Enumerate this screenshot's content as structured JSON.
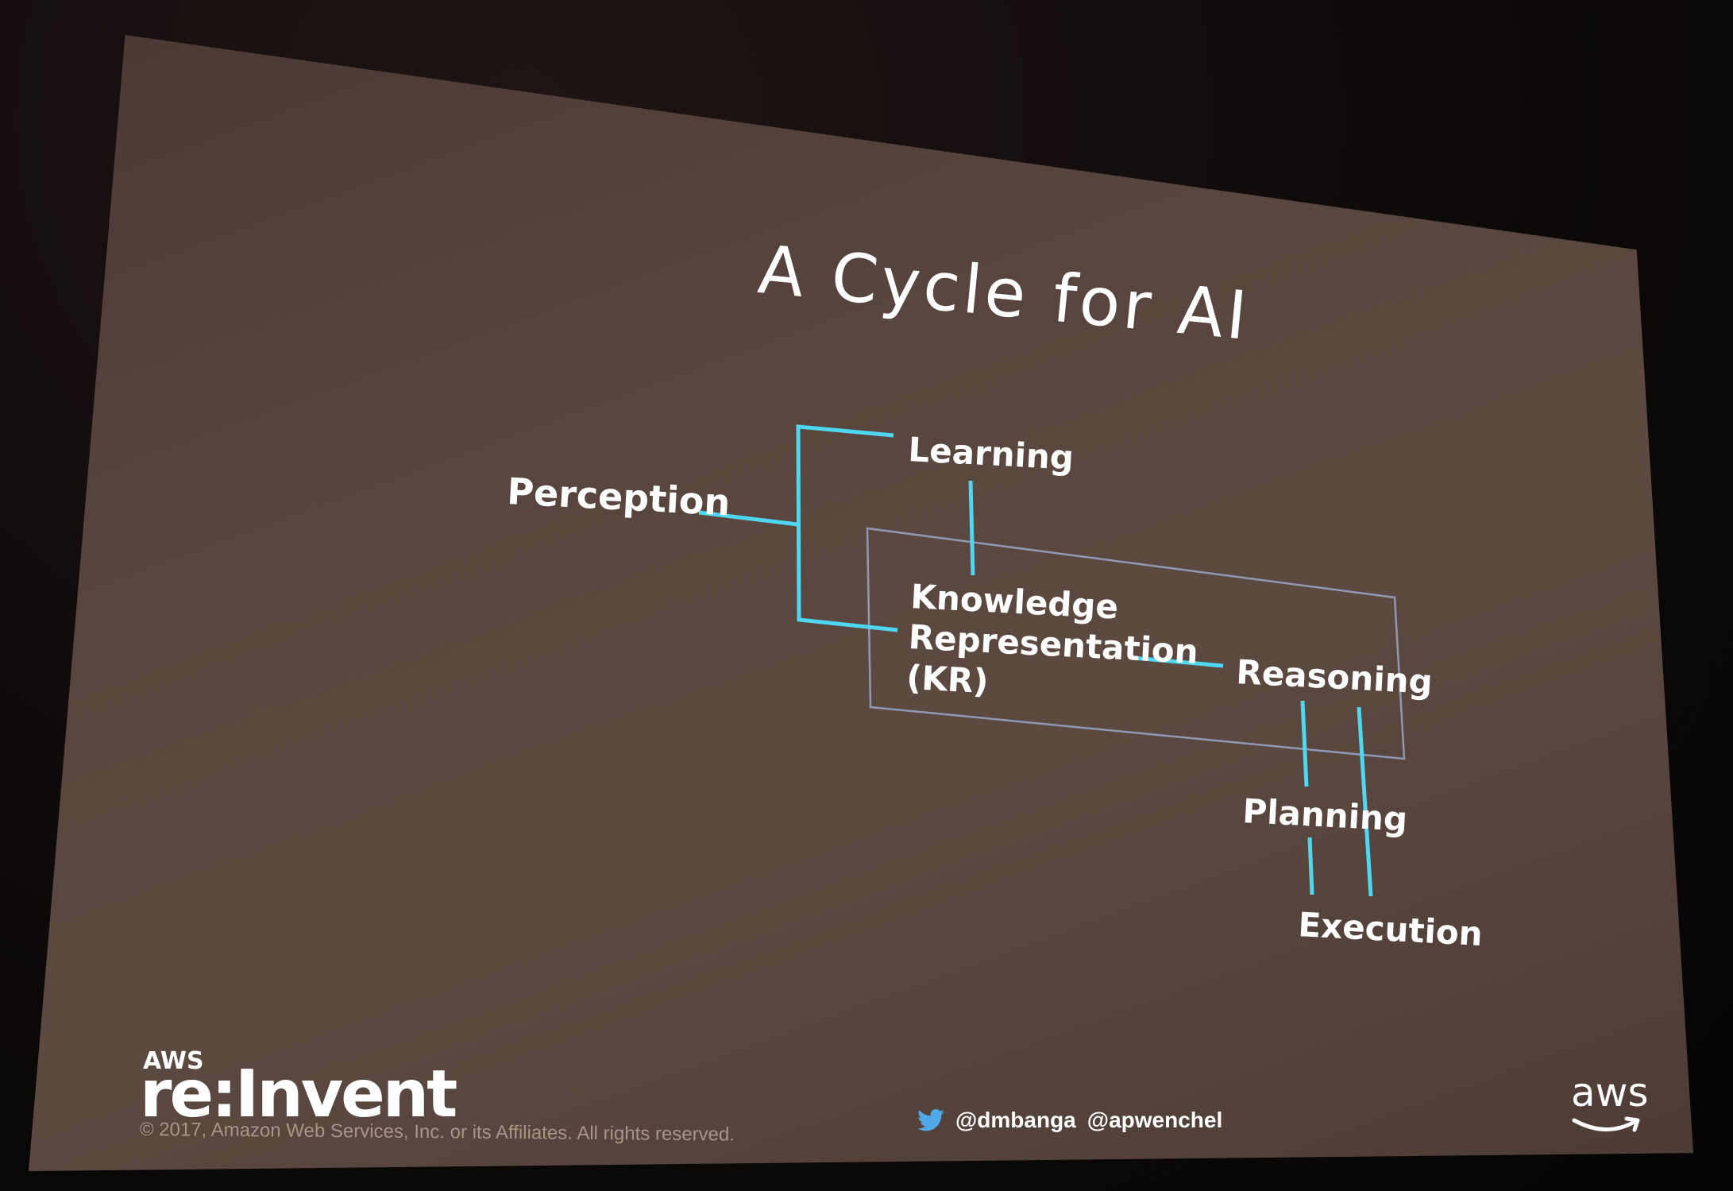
{
  "slide": {
    "title": "A Cycle for AI"
  },
  "diagram": {
    "nodes": {
      "perception": "Perception",
      "learning": "Learning",
      "kr_line1": "Knowledge",
      "kr_line2": "Representation",
      "kr_line3": "(KR)",
      "reasoning": "Reasoning",
      "planning": "Planning",
      "execution": "Execution"
    },
    "colors": {
      "connector": "#4fd6f0",
      "box_outline": "#9aa6c8",
      "text": "#ffffff"
    }
  },
  "footer": {
    "logo_small": "AWS",
    "logo_big": "re:Invent",
    "copyright": "© 2017, Amazon Web Services, Inc. or its Affiliates. All rights reserved.",
    "handle1": "@dmbanga",
    "handle2": "@apwenchel",
    "aws_logo": "aws"
  }
}
